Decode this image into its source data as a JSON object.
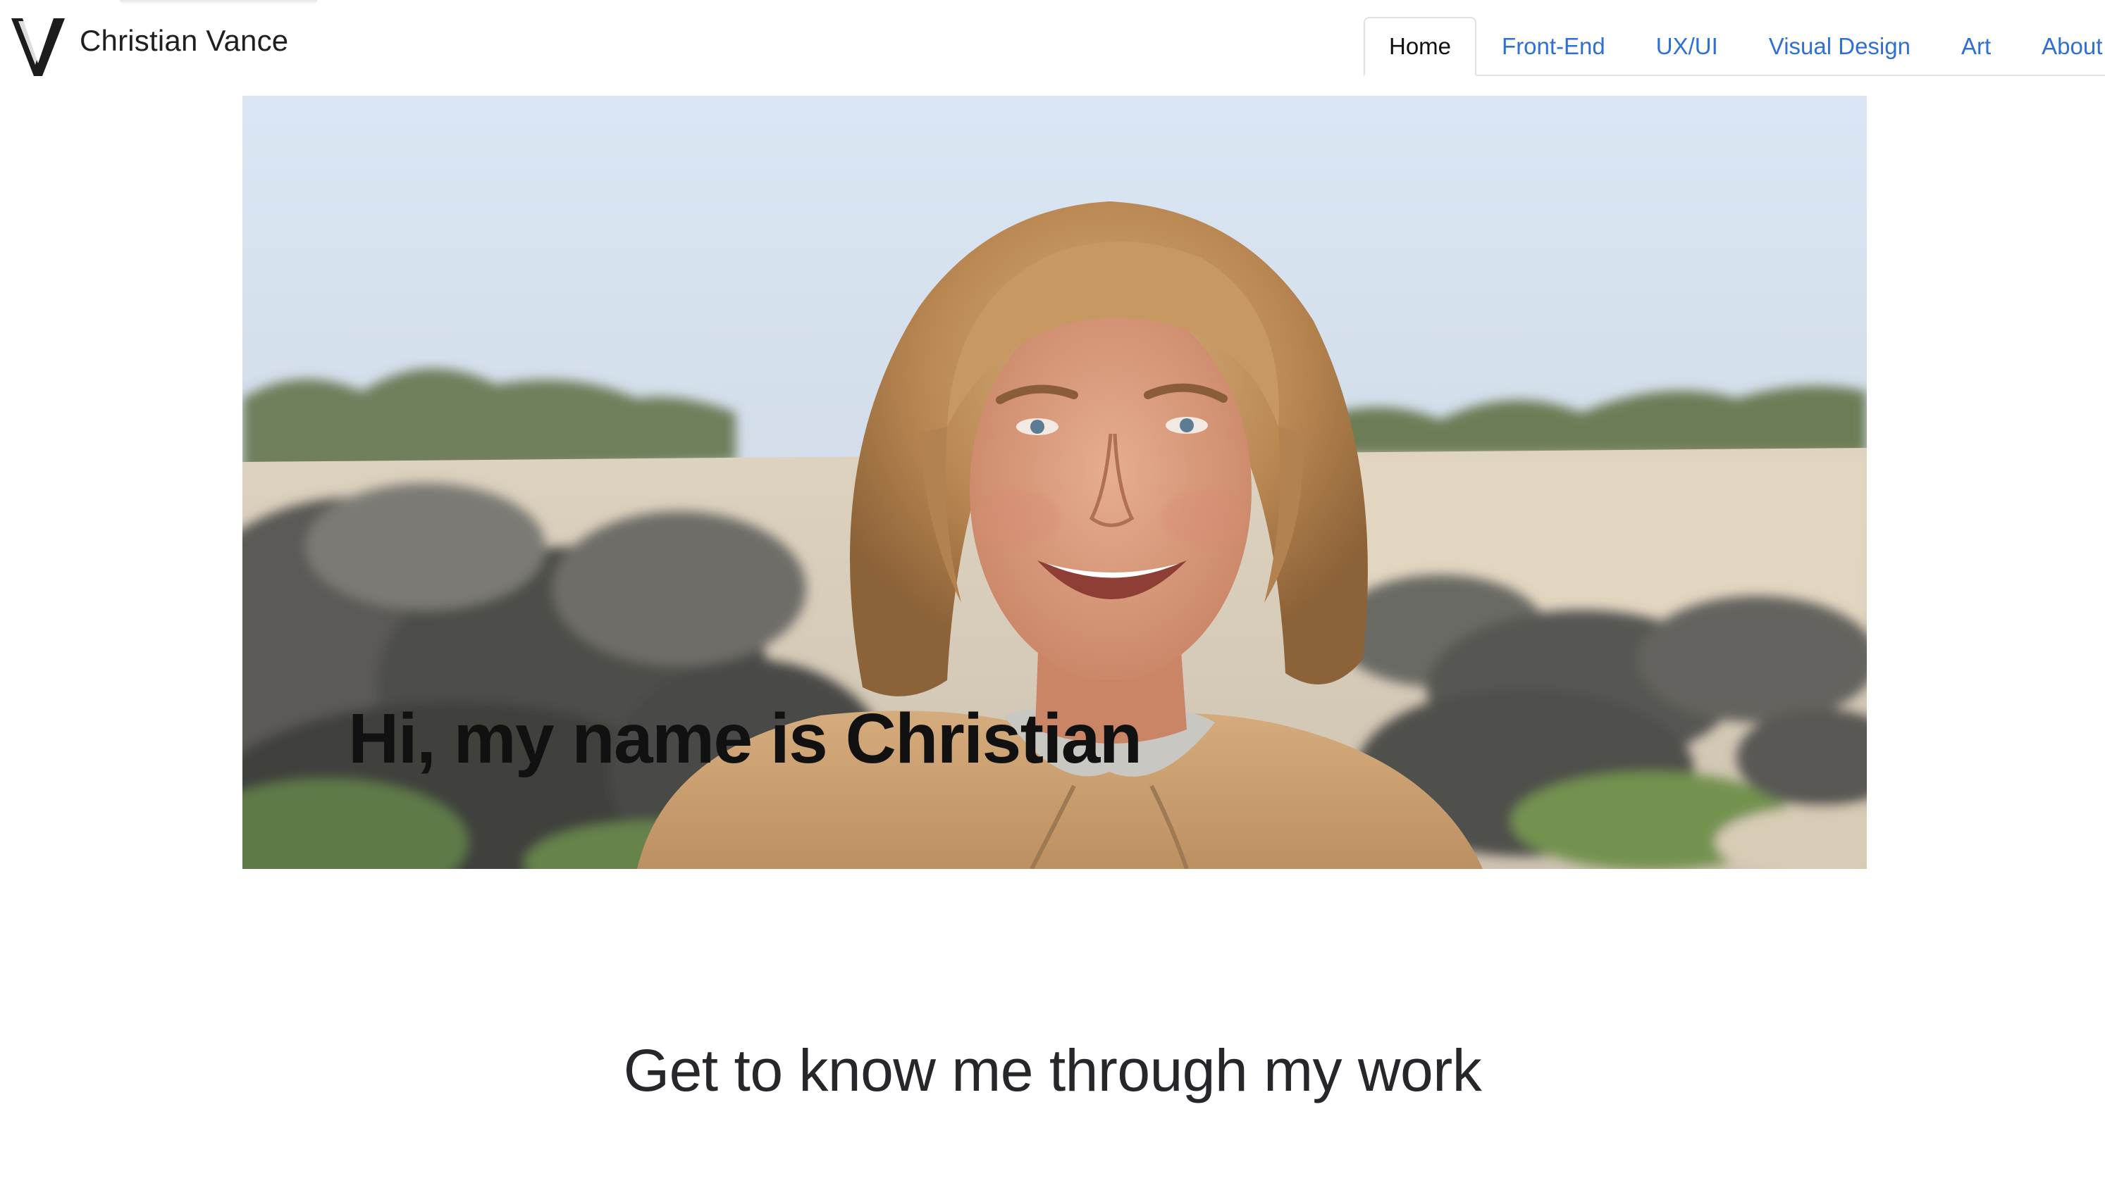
{
  "brand": {
    "name": "Christian Vance",
    "logo_icon": "v-monogram-logo"
  },
  "nav": {
    "items": [
      {
        "label": "Home",
        "active": true
      },
      {
        "label": "Front-End",
        "active": false
      },
      {
        "label": "UX/UI",
        "active": false
      },
      {
        "label": "Visual Design",
        "active": false
      },
      {
        "label": "Art",
        "active": false
      },
      {
        "label": "About",
        "active": false
      }
    ],
    "colors": {
      "link": "#2f6fd6",
      "active": "#111111",
      "border": "#dee2e6"
    }
  },
  "hero": {
    "heading": "Hi, my name is Christian",
    "image": "portrait-photo-beach"
  },
  "section": {
    "title": "Get to know me through my work"
  }
}
